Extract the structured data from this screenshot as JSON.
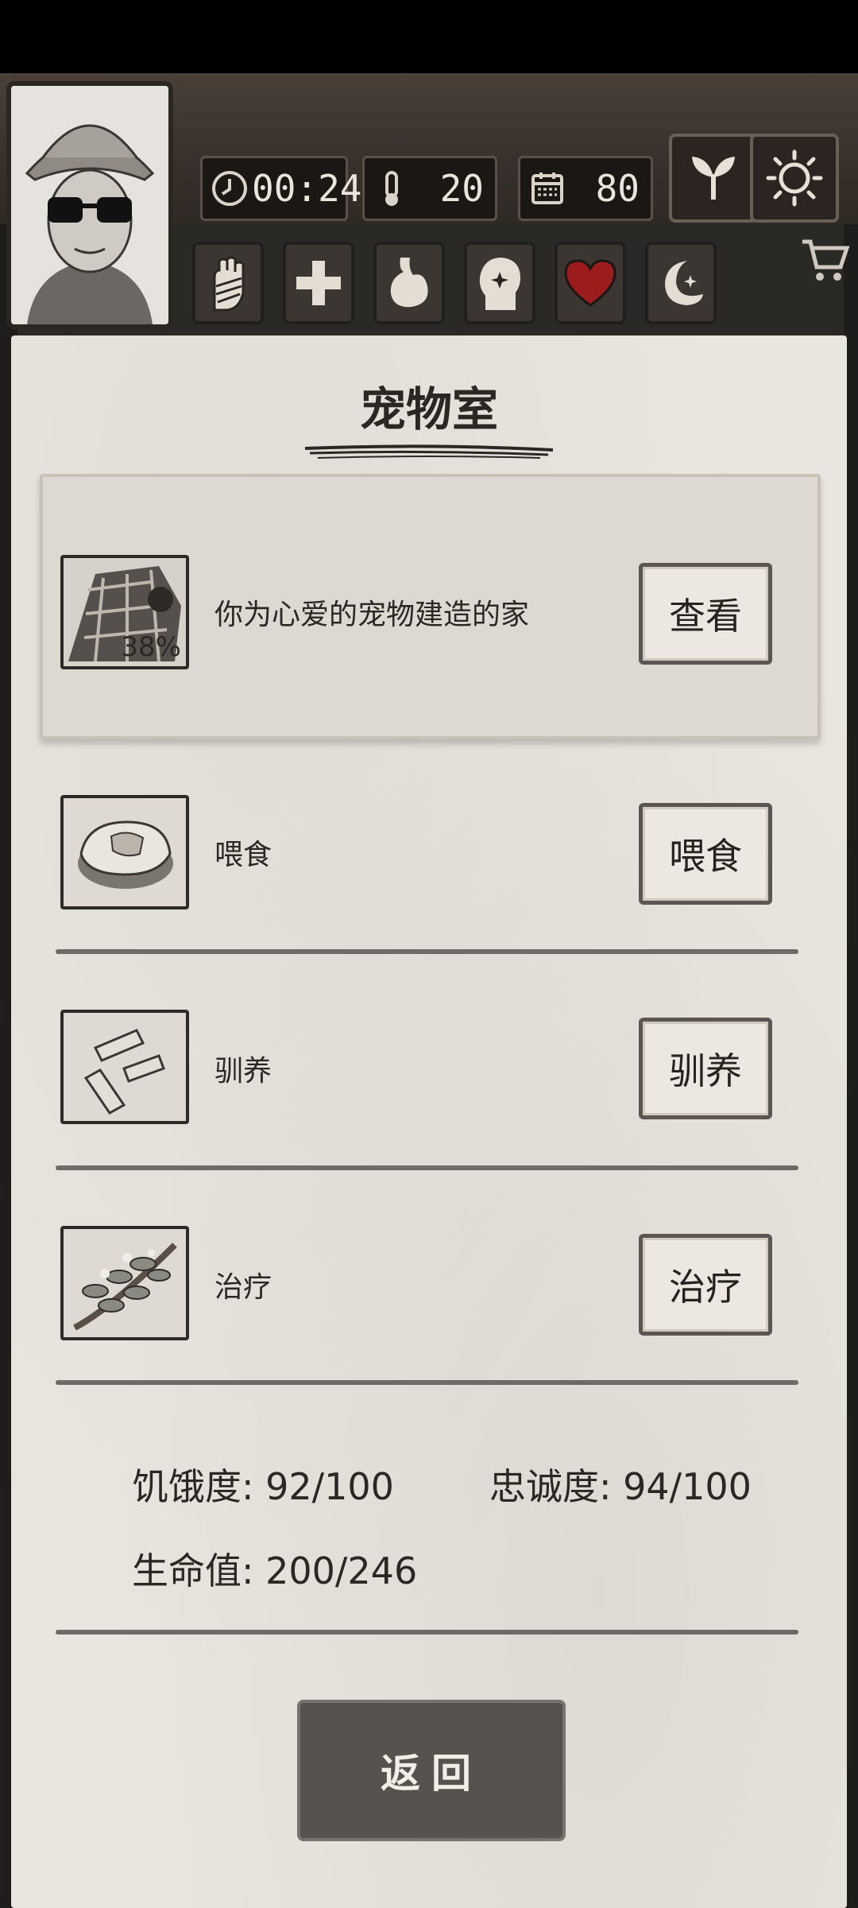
{
  "hud": {
    "time": "00:24",
    "temperature": "20",
    "days": "80"
  },
  "panel": {
    "title": "宠物室",
    "header_row": {
      "description": "你为心爱的宠物建造的家",
      "progress_badge": "38%",
      "button_label": "查看"
    },
    "actions": [
      {
        "text": "喂食",
        "button_label": "喂食"
      },
      {
        "text": "驯养",
        "button_label": "驯养"
      },
      {
        "text": "治疗",
        "button_label": "治疗"
      }
    ],
    "stats": {
      "hunger": "饥饿度: 92/100",
      "loyalty": "忠诚度: 94/100",
      "health": "生命值: 200/246"
    },
    "back_label": "返回"
  },
  "icons": {
    "clock": "clock-icon",
    "thermometer": "thermometer-icon",
    "calendar": "calendar-icon",
    "sprout": "sprout-icon",
    "sun": "sun-icon",
    "bandaged_hand": "bandaged-hand-icon",
    "cross": "medical-cross-icon",
    "stomach": "stomach-icon",
    "head": "head-sparkle-icon",
    "heart": "heart-icon",
    "moon": "moon-icon",
    "cart": "cart-icon"
  },
  "colors": {
    "heart": "#9c1c1c",
    "paper": "#e9e6df",
    "back_button": "#555250"
  }
}
